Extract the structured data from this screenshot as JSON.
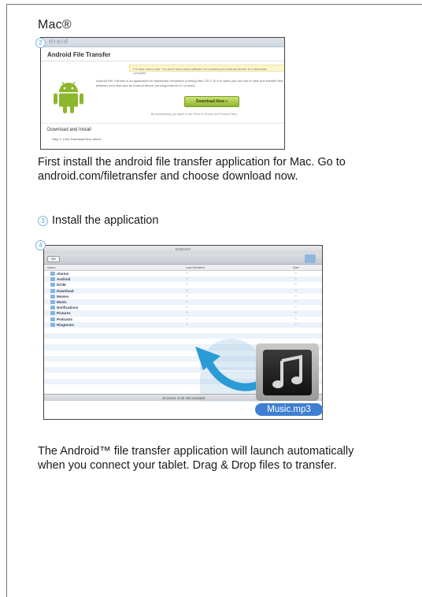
{
  "title": "Mac®",
  "step2": {
    "number": "2",
    "screenshot": {
      "header_logo": "droid",
      "heading": "Android File Transfer",
      "notice": "For Mac users only: You don't need extra software to connect your Android device to a Windows computer.",
      "description": "Android File Transfer is an application for Macintosh computers (running Mac OS X 10.5 or later) you can use to view and transfer files between your Mac and an Android device (running Android 3.0 or later).",
      "download_button": "Download Now »",
      "terms_note": "By downloading, you agree to our Terms of Service and Privacy Policy",
      "section_heading": "Download and Install",
      "step_text": "Step 1: Click Download Now above."
    },
    "caption": [
      "First install the android file transfer application for Mac. Go to",
      "android.com/filetransfer  and choose download now."
    ]
  },
  "step3": {
    "number": "3",
    "label": "Install the application"
  },
  "step4": {
    "number": "4",
    "finder": {
      "window_title": "ECB2167",
      "nav": "◂ ▸",
      "col_name": "Name",
      "col_modified": "Last Modified",
      "col_size": "Size",
      "folders": [
        "Alarms",
        "Android",
        "DCIM",
        "Download",
        "Movies",
        "Music",
        "Notifications",
        "Pictures",
        "Podcasts",
        "Ringtones"
      ],
      "dash": "--",
      "status": "10 items, 5.46 GB available"
    },
    "file_label": "Music.mp3",
    "caption": [
      "The Android™ file transfer application will launch automatically",
      "when you connect your tablet. Drag & Drop files to transfer."
    ]
  },
  "colors": {
    "accent": "#5aa2d4",
    "android_green": "#8cb72c",
    "arrow_blue": "#2b9bd6",
    "file_label_bg": "#3f7fd2"
  }
}
